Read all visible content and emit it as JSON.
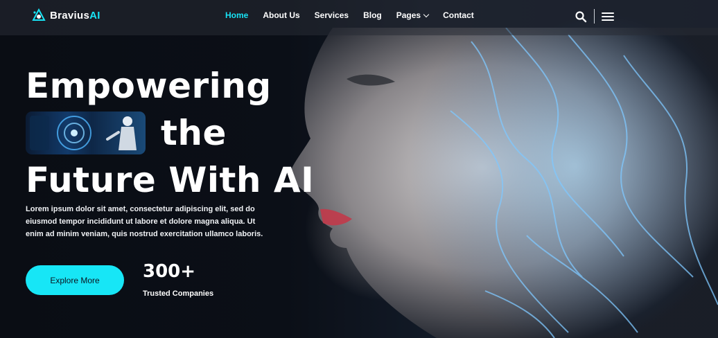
{
  "brand": {
    "name_main": "Bravius",
    "name_accent": "AI",
    "accent_color": "#18e4f5"
  },
  "nav": {
    "items": [
      {
        "label": "Home",
        "active": true
      },
      {
        "label": "About Us"
      },
      {
        "label": "Services"
      },
      {
        "label": "Blog"
      },
      {
        "label": "Pages",
        "has_dropdown": true
      },
      {
        "label": "Contact"
      }
    ]
  },
  "icons": {
    "search": "search-icon",
    "menu": "hamburger-menu-icon",
    "logo": "robot-logo-icon"
  },
  "hero": {
    "line1": "Empowering",
    "line2": "the",
    "line3": "Future With AI",
    "description": "Lorem ipsum dolor sit amet, consectetur adipiscing elit, sed do eiusmod tempor incididunt ut labore et dolore magna aliqua. Ut enim ad minim veniam, quis nostrud exercitation ullamco laboris.",
    "cta_label": "Explore More",
    "stat_value": "300+",
    "stat_label": "Trusted Companies"
  }
}
